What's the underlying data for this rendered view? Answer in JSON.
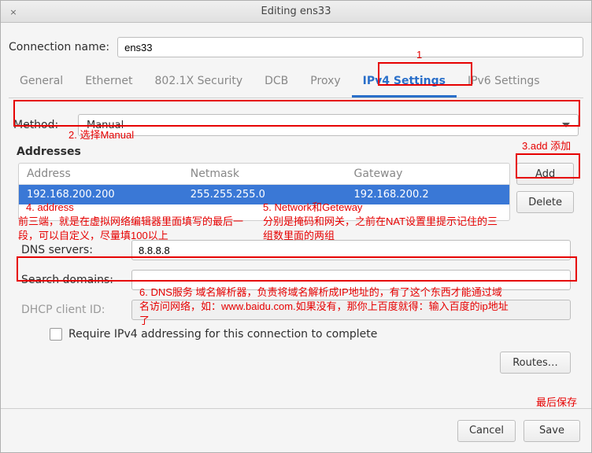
{
  "window": {
    "title": "Editing ens33",
    "close_glyph": "×"
  },
  "connection": {
    "label": "Connection name:",
    "value": "ens33"
  },
  "tabs": {
    "general": "General",
    "ethernet": "Ethernet",
    "security": "802.1X Security",
    "dcb": "DCB",
    "proxy": "Proxy",
    "ipv4": "IPv4 Settings",
    "ipv6": "IPv6 Settings"
  },
  "method": {
    "label": "Method:",
    "value": "Manual"
  },
  "addresses": {
    "label": "Addresses",
    "columns": {
      "address": "Address",
      "netmask": "Netmask",
      "gateway": "Gateway"
    },
    "rows": [
      {
        "address": "192.168.200.200",
        "netmask": "255.255.255.0",
        "gateway": "192.168.200.2"
      }
    ],
    "add": "Add",
    "delete": "Delete"
  },
  "dns": {
    "label": "DNS servers:",
    "value": "8.8.8.8"
  },
  "search_domains": {
    "label": "Search domains:",
    "value": ""
  },
  "dhcp_client_id": {
    "label": "DHCP client ID:",
    "value": ""
  },
  "require_checkbox": "Require IPv4 addressing for this connection to complete",
  "routes": "Routes…",
  "footer": {
    "cancel": "Cancel",
    "save": "Save"
  },
  "annotations": {
    "n1": "1",
    "n2": "2. 选择Manual",
    "n3": "3.add 添加",
    "n4_title": "4. address",
    "n4_body": "前三端，就是在虚拟网络编辑器里面填写的最后一段，可以自定义，尽量填100以上",
    "n5_title": "5. Network和Geteway",
    "n5_body": "分别是掩码和网关，之前在NAT设置里提示记住的三组数里面的两组",
    "n6": "6. DNS服务 域名解析器，负责将域名解析成IP地址的，有了这个东西才能通过域名访问网络，如：www.baidu.com.如果没有，那你上百度就得：输入百度的ip地址了",
    "last": "最后保存"
  }
}
